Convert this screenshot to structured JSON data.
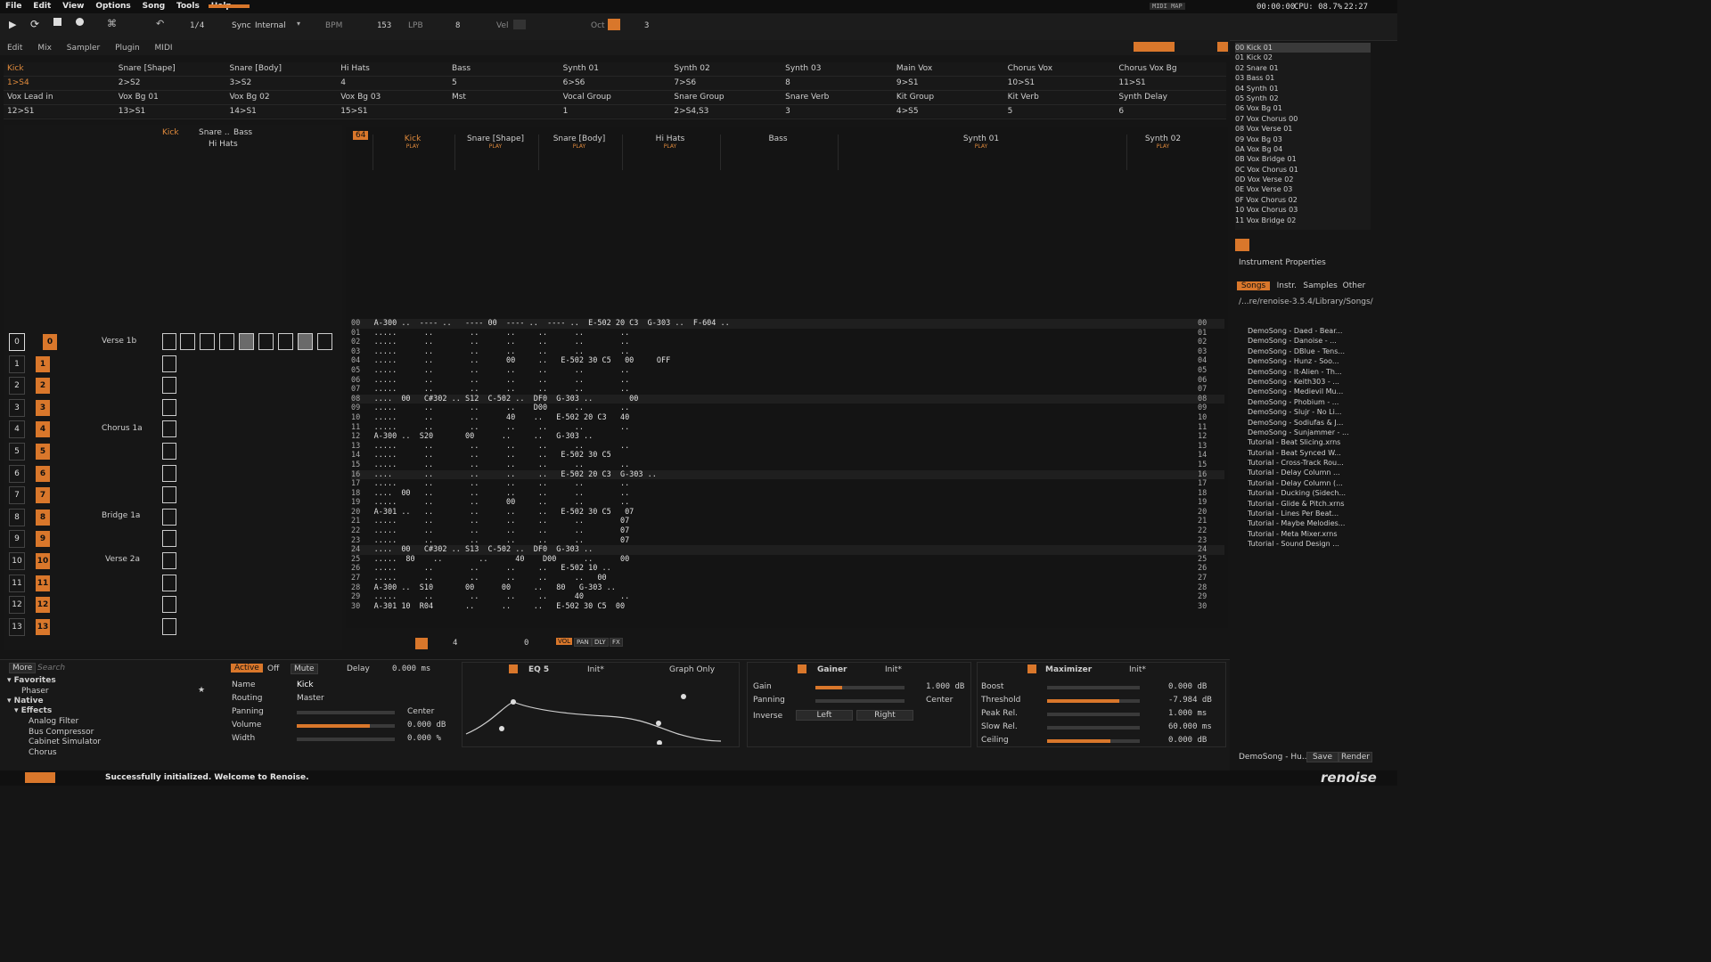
{
  "menu": [
    "File",
    "Edit",
    "View",
    "Options",
    "Song",
    "Tools",
    "Help"
  ],
  "topright": {
    "midi_map": "MIDI MAP",
    "time": "00:00:00",
    "cpu": "CPU: 08.7%",
    "clock": "22:27"
  },
  "transport": {
    "lines": "1/4",
    "sync_label": "Sync",
    "sync_value": "Internal",
    "bpm_label": "BPM",
    "bpm": "153",
    "lpb_label": "LPB",
    "lpb": "8",
    "vel_label": "Vel",
    "oct_label": "Oct",
    "oct": "3"
  },
  "tabs": [
    "Edit",
    "Mix",
    "Sampler",
    "Plugin",
    "MIDI"
  ],
  "tracks_row1": [
    "Kick",
    "Snare [Shape]",
    "Snare [Body]",
    "Hi Hats",
    "Bass",
    "Synth 01",
    "Synth 02",
    "Synth 03",
    "Main Vox",
    "Chorus Vox",
    "Chorus Vox Bg"
  ],
  "tracks_row2": [
    "1>S4",
    "2>S2",
    "3>S2",
    "4",
    "5",
    "6>S6",
    "7>S6",
    "8",
    "9>S1",
    "10>S1",
    "11>S1"
  ],
  "tracks_row3": [
    "Vox Lead in",
    "Vox Bg 01",
    "Vox Bg 02",
    "Vox Bg 03",
    "Mst",
    "Vocal Group",
    "Snare Group",
    "Snare Verb",
    "Kit Group",
    "Kit Verb",
    "Synth Delay"
  ],
  "tracks_row4": [
    "12>S1",
    "13>S1",
    "14>S1",
    "15>S1",
    "",
    "1",
    "2>S4,S3",
    "3",
    "4>S5",
    "5",
    "6"
  ],
  "seq_labels": {
    "verse1b": "Verse 1b",
    "chorus1a": "Chorus 1a",
    "bridge1a": "Bridge 1a",
    "verse2a": "Verse 2a"
  },
  "seq_numbers": [
    "0",
    "1",
    "2",
    "3",
    "4",
    "5",
    "6",
    "7",
    "8",
    "9",
    "10",
    "11",
    "12",
    "13"
  ],
  "seq_patterns": [
    "0",
    "1",
    "2",
    "3",
    "4",
    "5",
    "6",
    "7",
    "8",
    "9",
    "10",
    "11",
    "12",
    "13"
  ],
  "pattern_lines": "64",
  "pattern_tracks": [
    {
      "name": "Kick",
      "sub": "PLAY"
    },
    {
      "name": "Snare [Shape]",
      "sub": "PLAY"
    },
    {
      "name": "Snare [Body]",
      "sub": "PLAY"
    },
    {
      "name": "Hi Hats",
      "sub": "PLAY"
    },
    {
      "name": "Bass",
      "sub": ""
    },
    {
      "name": "Synth 01",
      "sub": "PLAY"
    },
    {
      "name": "Synth 02",
      "sub": "PLAY"
    }
  ],
  "pattern_rows": [
    "A-300 ..  ---- ..   ---- 00  ---- ..  ---- ..  E-502 20 C3  G-303 ..  F-604 ..",
    ".....      ..        ..      ..     ..      ..        ..",
    ".....      ..        ..      ..     ..      ..        ..",
    ".....      ..        ..      ..     ..      ..        ..",
    ".....      ..        ..      00     ..   E-502 30 C5   00     OFF",
    ".....      ..        ..      ..     ..      ..        ..",
    ".....      ..        ..      ..     ..      ..        ..",
    ".....      ..        ..      ..     ..      ..        ..",
    "....  00   C#302 .. S12  C-502 ..  DF0  G-303 ..        00",
    ".....      ..        ..      ..    D00      ..        ..",
    ".....      ..        ..      40    ..   E-502 20 C3   40",
    ".....      ..        ..      ..     ..      ..        ..",
    "A-300 ..  S20       00      ..     ..   G-303 ..",
    ".....      ..        ..      ..     ..      ..        ..",
    ".....      ..        ..      ..     ..   E-502 30 C5",
    ".....      ..        ..      ..     ..      ..        ..",
    "....       ..        ..      ..     ..   E-502 20 C3  G-303 ..",
    ".....      ..        ..      ..     ..      ..        ..",
    "....  00   ..        ..      ..     ..      ..        ..",
    ".....      ..        ..      00     ..      ..        ..",
    "A-301 ..   ..        ..      ..     ..   E-502 30 C5   07",
    ".....      ..        ..      ..     ..      ..        07",
    ".....      ..        ..      ..     ..      ..        07",
    ".....      ..        ..      ..     ..      ..        07",
    "....  00   C#302 .. S13  C-502 ..  DF0  G-303 ..",
    ".....  80    ..        ..      40    D00      ..      00",
    ".....      ..        ..      ..     ..   E-502 10 ..",
    ".....      ..        ..      ..     ..      ..   00",
    "A-300 ..  S10       00      00     ..   80   G-303 ..",
    ".....      ..        ..      ..     ..      40        ..",
    "A-301 10  R04       ..      ..     ..   E-502 30 C5  00"
  ],
  "row_numbers": [
    "00",
    "01",
    "02",
    "03",
    "04",
    "05",
    "06",
    "07",
    "08",
    "09",
    "10",
    "11",
    "12",
    "13",
    "14",
    "15",
    "16",
    "17",
    "18",
    "19",
    "20",
    "21",
    "22",
    "23",
    "24",
    "25",
    "26",
    "27",
    "28",
    "29",
    "30"
  ],
  "pattern_toolbar": {
    "edit_step": "4",
    "coarse": "0",
    "vol": "VOL",
    "pan": "PAN",
    "dly": "DLY",
    "fx": "FX"
  },
  "bottom": {
    "more": "More",
    "search_placeholder": "Search",
    "favorites": "Favorites",
    "phaser": "Phaser",
    "native": "Native",
    "effects": "Effects",
    "fx_list": [
      "Analog Filter",
      "Bus Compressor",
      "Cabinet Simulator",
      "Chorus"
    ],
    "active": "Active",
    "off": "Off",
    "mute": "Mute",
    "delay_label": "Delay",
    "delay_value": "0.000 ms",
    "name_label": "Name",
    "name_value": "Kick",
    "routing_label": "Routing",
    "routing_value": "Master",
    "panning_label": "Panning",
    "center": "Center",
    "volume_label": "Volume",
    "volume_value": "0.000 dB",
    "width_label": "Width",
    "width_value": "0.000 %",
    "eq_title": "EQ 5",
    "eq_preset": "Init*",
    "graph_only": "Graph Only",
    "gainer_title": "Gainer",
    "gainer_preset": "Init*",
    "gain_label": "Gain",
    "gain_value": "1.000 dB",
    "gpanning_label": "Panning",
    "gpanning_value": "Center",
    "inverse_label": "Inverse",
    "left": "Left",
    "right": "Right",
    "max_title": "Maximizer",
    "max_preset": "Init*",
    "max_rows": [
      {
        "label": "Boost",
        "value": "0.000 dB"
      },
      {
        "label": "Threshold",
        "value": "-7.984 dB"
      },
      {
        "label": "Peak Rel.",
        "value": "1.000 ms"
      },
      {
        "label": "Slow Rel.",
        "value": "60.000 ms"
      },
      {
        "label": "Ceiling",
        "value": "0.000 dB"
      }
    ],
    "max_fills": [
      0.0,
      0.78,
      0.0,
      0.0,
      0.68
    ]
  },
  "status": {
    "message": "Successfully initialized. Welcome to Renoise.",
    "logo": "renoise"
  },
  "instruments": [
    "00  Kick 01",
    "01  Kick 02",
    "02  Snare 01",
    "03  Bass 01",
    "04  Synth 01",
    "05  Synth 02",
    "06  Vox Bg 01",
    "07  Vox Chorus 00",
    "08  Vox Verse 01",
    "09  Vox Bg 03",
    "0A  Vox Bg 04",
    "0B  Vox Bridge 01",
    "0C  Vox Chorus 01",
    "0D  Vox Verse 02",
    "0E  Vox Verse 03",
    "0F  Vox Chorus 02",
    "10  Vox Chorus 03",
    "11  Vox Bridge 02"
  ],
  "instrument_properties": "Instrument Properties",
  "browser_tabs": [
    "Songs",
    "Instr.",
    "Samples",
    "Other"
  ],
  "browser_path": "/...re/renoise-3.5.4/Library/Songs/",
  "files": [
    "DemoSong - Daed - Bear...",
    "DemoSong - Danoise - ...",
    "DemoSong - DBlue - Tens...",
    "DemoSong - Hunz - Soo...",
    "DemoSong - It-Alien - Th...",
    "DemoSong - Keith303 - ...",
    "DemoSong - Medievil Mu...",
    "DemoSong - Phobium - ...",
    "DemoSong - Slujr - No Li...",
    "DemoSong - Sodiufas & J...",
    "DemoSong - Sunjammer - ...",
    "Tutorial - Beat Slicing.xrns",
    "Tutorial - Beat Synced W...",
    "Tutorial - Cross-Track Rou...",
    "Tutorial - Delay Column ...",
    "Tutorial - Delay Column (...",
    "Tutorial - Ducking (Sidech...",
    "Tutorial - Glide & Pitch.xrns",
    "Tutorial - Lines Per Beat...",
    "Tutorial - Maybe Melodies...",
    "Tutorial - Meta Mixer.xrns",
    "Tutorial - Sound Design ..."
  ],
  "browser_bottom": {
    "song": "DemoSong - Hu...",
    "save": "Save",
    "render": "Render"
  },
  "colors": {
    "accent": "#d9772b",
    "note": "#e2e2e2",
    "volume": "#b9e05a",
    "effect": "#d8553e",
    "cyan": "#4ab0e8"
  }
}
